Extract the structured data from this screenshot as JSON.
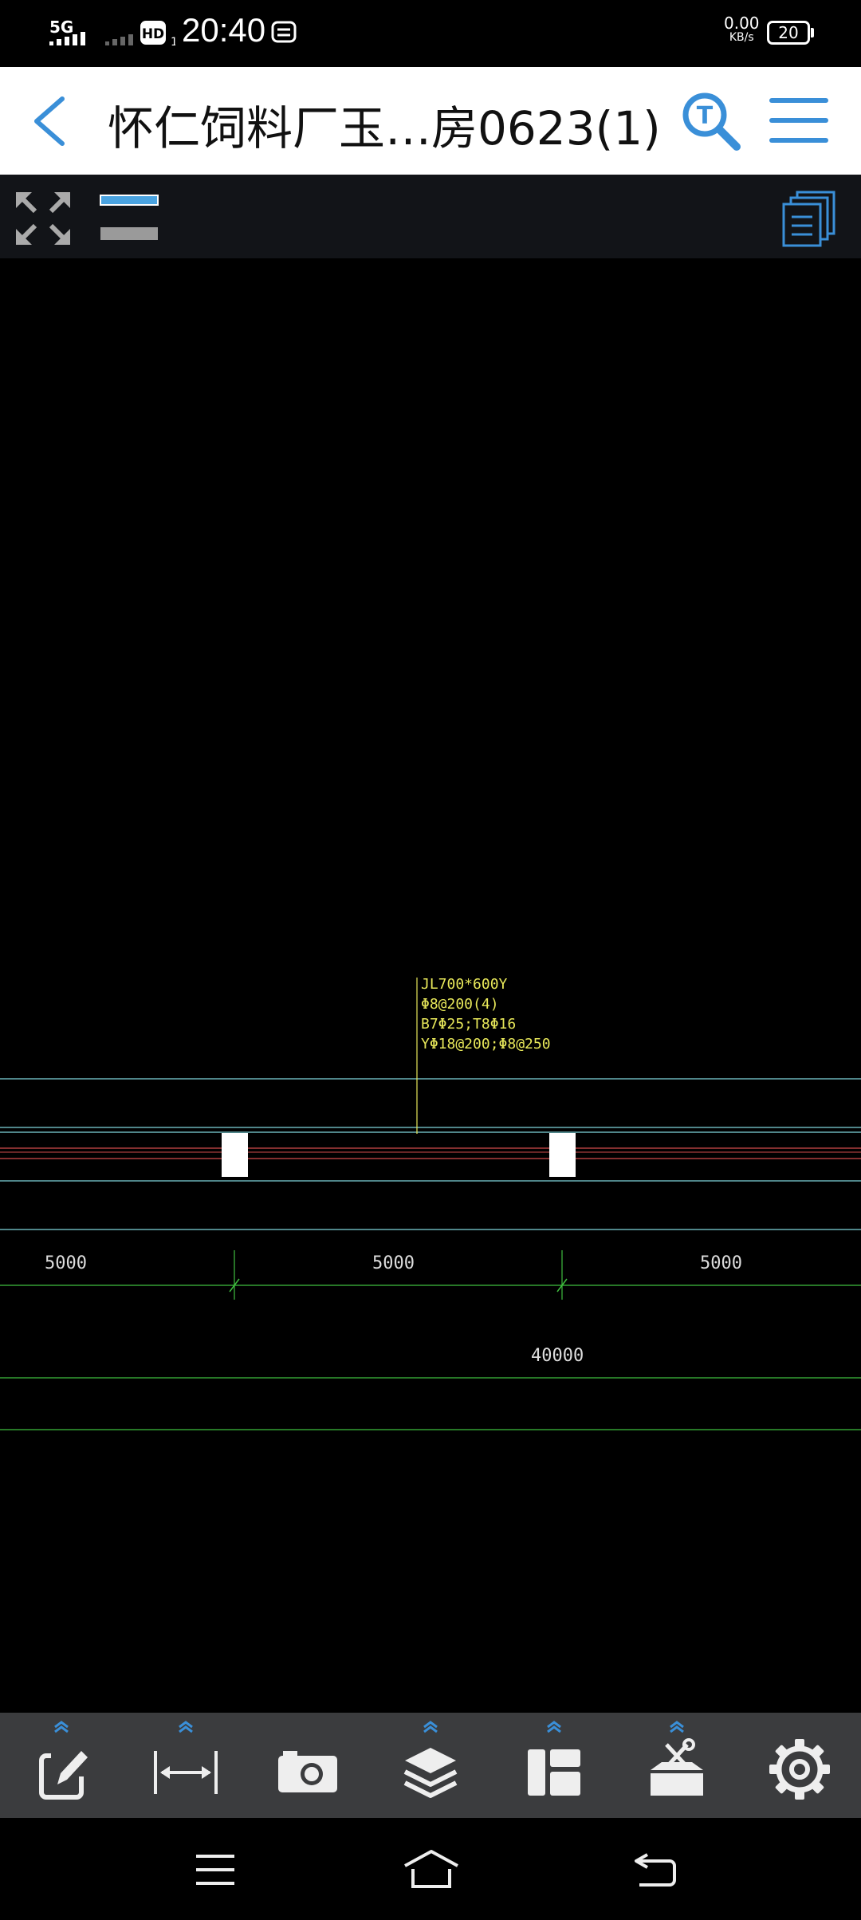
{
  "status_bar": {
    "network": "5G",
    "time": "20:40",
    "speed_value": "0.00",
    "speed_unit": "KB/s",
    "battery": "20"
  },
  "title_bar": {
    "title": "怀仁饲料厂玉…房0623(1)",
    "back_icon": "chevron-left-icon",
    "search_icon": "text-search-icon",
    "menu_icon": "hamburger-menu-icon"
  },
  "sub_toolbar": {
    "fullscreen_icon": "expand-arrows-icon",
    "line_weight_icon": "line-weight-icon",
    "layouts_icon": "stacked-documents-icon"
  },
  "drawing": {
    "beam_label": [
      "JL700*600Y",
      "Φ8@200(4)",
      "B7Φ25;T8Φ16",
      "YΦ18@200;Φ8@250"
    ],
    "dimensions": [
      "5000",
      "5000",
      "5000"
    ],
    "total_dimension": "40000",
    "colors": {
      "cyan_line": "#7fd6dd",
      "red_line": "#d24b4b",
      "green_line": "#3fbf3f",
      "yellow_text": "#e8e85a",
      "column_fill": "#ffffff"
    }
  },
  "bottom_toolbar": {
    "tools": [
      {
        "name": "annotate",
        "icon": "edit-icon",
        "has_expand": true
      },
      {
        "name": "measure",
        "icon": "measure-distance-icon",
        "has_expand": true
      },
      {
        "name": "screenshot",
        "icon": "camera-icon",
        "has_expand": false
      },
      {
        "name": "layers",
        "icon": "layers-icon",
        "has_expand": true
      },
      {
        "name": "layout",
        "icon": "layout-icon",
        "has_expand": true
      },
      {
        "name": "toolbox",
        "icon": "toolbox-icon",
        "has_expand": true
      },
      {
        "name": "settings",
        "icon": "gear-icon",
        "has_expand": false
      }
    ],
    "accent": "#3a8fd8"
  },
  "nav_bar": {
    "menu_icon": "nav-menu-icon",
    "home_icon": "nav-home-icon",
    "back_icon": "nav-back-icon"
  }
}
